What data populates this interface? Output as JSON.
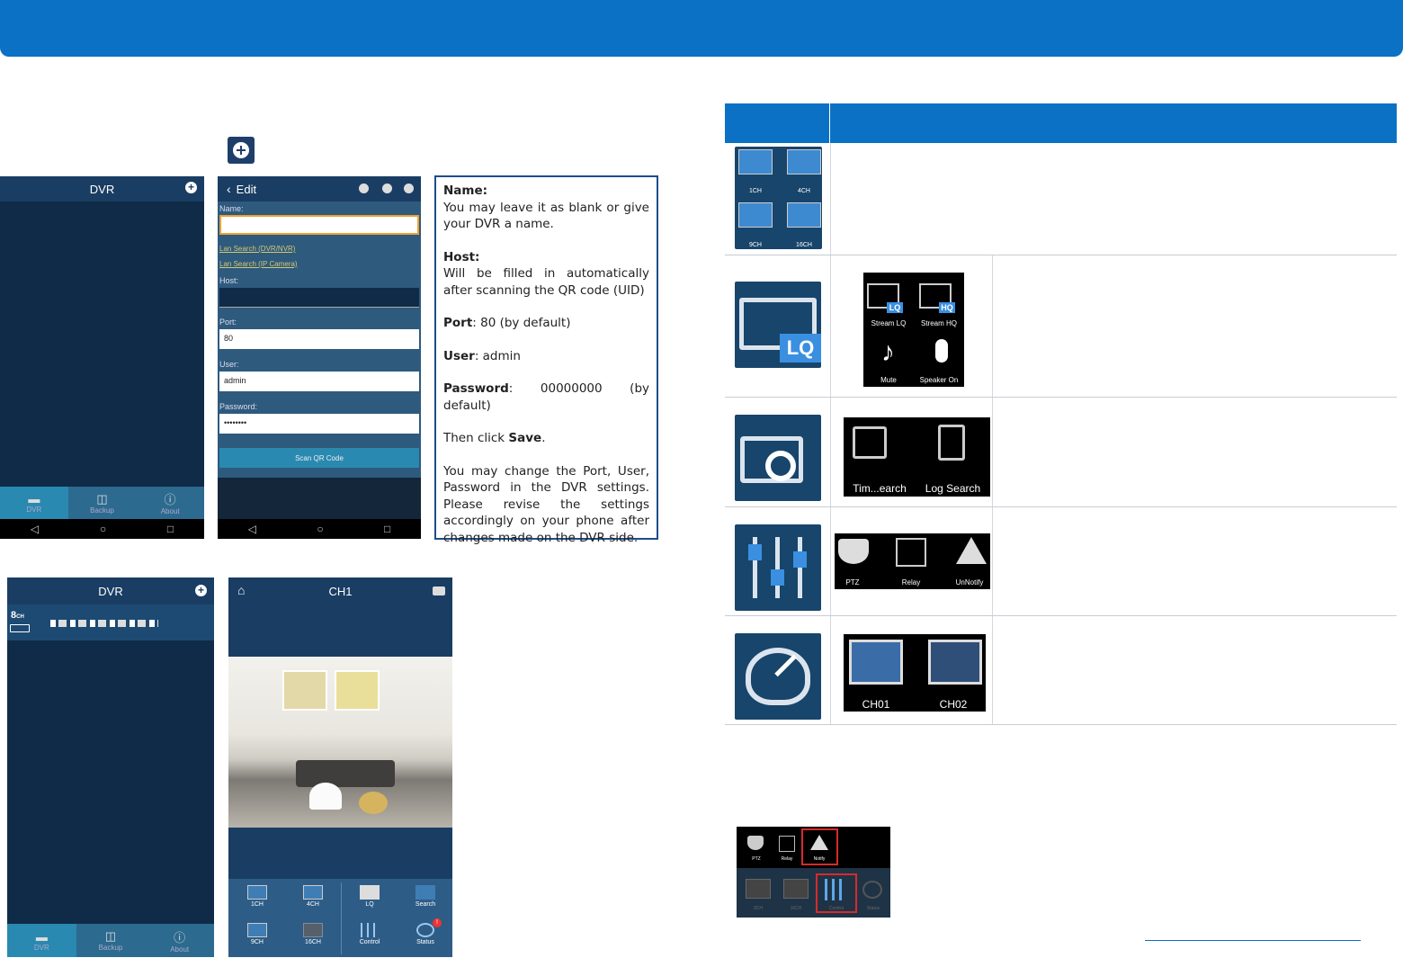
{
  "screens": {
    "dvr_empty": {
      "title": "DVR",
      "tabs": [
        "DVR",
        "Backup",
        "About"
      ]
    },
    "edit": {
      "title": "Edit",
      "name_label": "Name:",
      "lan_search_dvr": "Lan Search (DVR/NVR)",
      "lan_search_ip": "Lan Search (IP Camera)",
      "host_label": "Host:",
      "port_label": "Port:",
      "port_value": "80",
      "user_label": "User:",
      "user_value": "admin",
      "password_label": "Password:",
      "password_value": "••••••••",
      "scan_button": "Scan QR Code"
    },
    "dvr_list": {
      "title": "DVR",
      "device_badge": "8",
      "device_badge_unit": "CH",
      "tabs": [
        "DVR",
        "Backup",
        "About"
      ]
    },
    "live": {
      "title": "CH1",
      "buttons": [
        "1CH",
        "4CH",
        "LQ",
        "Search",
        "9CH",
        "16CH",
        "Control",
        "Status"
      ],
      "status_badge": "!"
    }
  },
  "note": {
    "name_heading": "Name:",
    "name_text": "You may leave it as blank or give your DVR a name.",
    "host_heading": "Host:",
    "host_text": "Will be filled in automatically after scanning the QR code (UID)",
    "port_heading": "Port",
    "port_text": ": 80 (by default)",
    "user_heading": "User",
    "user_text": ": admin",
    "password_heading": "Password",
    "password_text": ": 00000000 (by default)",
    "then_click": "Then click ",
    "save": "Save",
    "period": ".",
    "change_text": "You may change the Port, User, Password in the DVR settings. Please revise the settings accordingly on your phone after changes made on the DVR side."
  },
  "table": {
    "row1_labels": [
      "1CH",
      "4CH",
      "9CH",
      "16CH"
    ],
    "row2_labels": [
      "Stream LQ",
      "Stream HQ",
      "Mute",
      "Speaker On"
    ],
    "row2_badges": [
      "LQ",
      "HQ"
    ],
    "row2_icon_badge": "LQ",
    "row3_labels": [
      "Tim...earch",
      "Log Search"
    ],
    "row4_labels": [
      "PTZ",
      "Relay",
      "UnNotify"
    ],
    "row5_labels": [
      "CH01",
      "CH02"
    ]
  },
  "bottom_shot": {
    "top_labels": [
      "PTZ",
      "Relay",
      "Notify"
    ],
    "bottom_labels": [
      "9CH",
      "16CH",
      "Control",
      "Status"
    ]
  },
  "colors": {
    "brand": "#0b71c4",
    "phone_bg": "#0f2b47",
    "phone_head": "#1a3d63",
    "icon_bg": "#18456b"
  }
}
